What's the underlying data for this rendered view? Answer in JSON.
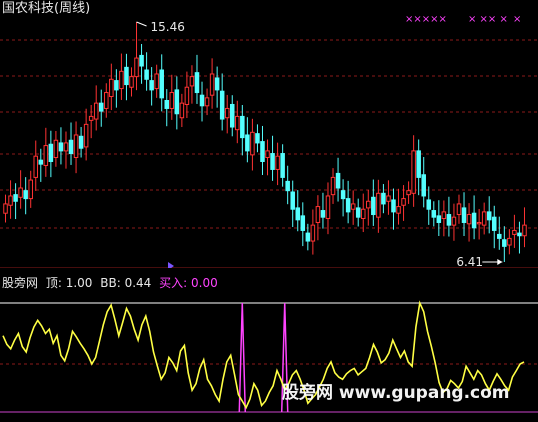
{
  "chart_title": "国农科技(周线)",
  "main_chart": {
    "high_label": "15.46",
    "low_label": "6.41",
    "colors": {
      "up": "#ff3333",
      "down": "#54ffff",
      "background": "#000000",
      "grid": "#8b1a1a",
      "marker": "#ff44ff"
    },
    "top_marker_groups": [
      "×××××",
      "× ×× ×",
      "×"
    ]
  },
  "indicator": {
    "name": "股旁网",
    "labels": [
      {
        "key": "顶",
        "value": "1.00"
      },
      {
        "key": "BB",
        "value": "0.44"
      },
      {
        "key": "买入",
        "value": "0.00"
      }
    ],
    "colors": {
      "line": "#ffff44",
      "buy": "#ff44ff",
      "top_line": "#ffffff",
      "baseline": "#cc44cc"
    }
  },
  "watermark": "股旁网  www.gupang.com",
  "chart_data": [
    {
      "type": "candlestick",
      "title": "国农科技(周线)",
      "annotations": [
        {
          "text": "15.46",
          "kind": "high"
        },
        {
          "text": "6.41",
          "kind": "low"
        }
      ],
      "close": [
        8.6,
        8.9,
        8.7,
        9.2,
        8.8,
        9.5,
        10.4,
        10.1,
        10.8,
        10.2,
        11.0,
        10.6,
        10.9,
        10.5,
        11.2,
        10.7,
        11.6,
        11.9,
        12.4,
        12.1,
        12.8,
        13.3,
        12.9,
        13.6,
        13.1,
        13.4,
        14.1,
        13.8,
        13.3,
        12.9,
        13.5,
        12.6,
        12.2,
        12.8,
        12.0,
        12.4,
        13.0,
        13.4,
        12.8,
        12.3,
        12.6,
        13.5,
        12.9,
        11.8,
        12.2,
        11.5,
        11.9,
        11.1,
        10.6,
        11.3,
        10.9,
        10.2,
        10.6,
        9.9,
        10.4,
        9.6,
        9.1,
        8.4,
        8.0,
        7.6,
        7.2,
        7.8,
        8.5,
        8.1,
        8.9,
        9.6,
        9.2,
        8.8,
        8.3,
        8.6,
        8.1,
        8.4,
        8.7,
        8.2,
        9.0,
        8.6,
        8.9,
        8.3,
        8.5,
        8.8,
        9.1,
        10.6,
        9.6,
        8.9,
        8.4,
        8.1,
        7.9,
        8.3,
        7.8,
        8.1,
        8.6,
        7.9,
        8.2,
        7.7,
        7.9,
        8.3,
        8.0,
        7.6,
        7.3,
        7.0,
        7.3,
        7.6,
        7.4,
        7.8
      ],
      "high_value": 15.46,
      "low_value": 6.41
    },
    {
      "type": "line",
      "title": "股旁网",
      "y": [
        0.7,
        0.62,
        0.58,
        0.66,
        0.72,
        0.6,
        0.55,
        0.68,
        0.78,
        0.84,
        0.79,
        0.72,
        0.76,
        0.63,
        0.7,
        0.52,
        0.47,
        0.58,
        0.74,
        0.69,
        0.63,
        0.58,
        0.52,
        0.44,
        0.5,
        0.65,
        0.8,
        0.92,
        0.98,
        0.85,
        0.7,
        0.82,
        0.95,
        0.88,
        0.76,
        0.66,
        0.8,
        0.88,
        0.74,
        0.55,
        0.42,
        0.3,
        0.36,
        0.5,
        0.45,
        0.38,
        0.56,
        0.61,
        0.36,
        0.2,
        0.26,
        0.4,
        0.48,
        0.3,
        0.24,
        0.16,
        0.1,
        0.3,
        0.46,
        0.52,
        0.34,
        0.16,
        0.1,
        0.04,
        0.12,
        0.26,
        0.2,
        0.06,
        0.1,
        0.18,
        0.24,
        0.38,
        0.3,
        0.2,
        0.26,
        0.34,
        0.38,
        0.3,
        0.2,
        0.08,
        0.12,
        0.16,
        0.23,
        0.3,
        0.4,
        0.46,
        0.36,
        0.32,
        0.3,
        0.35,
        0.38,
        0.4,
        0.34,
        0.37,
        0.4,
        0.5,
        0.62,
        0.55,
        0.45,
        0.48,
        0.54,
        0.66,
        0.58,
        0.5,
        0.56,
        0.46,
        0.42,
        0.78,
        1.0,
        0.92,
        0.74,
        0.6,
        0.45,
        0.27,
        0.18,
        0.21,
        0.29,
        0.26,
        0.22,
        0.28,
        0.42,
        0.36,
        0.3,
        0.38,
        0.34,
        0.26,
        0.2,
        0.28,
        0.35,
        0.3,
        0.24,
        0.2,
        0.32,
        0.38,
        0.44,
        0.46
      ],
      "buy_spikes": [
        {
          "index": 62,
          "value": 1.0
        },
        {
          "index": 73,
          "value": 1.0
        }
      ],
      "reference_lines": [
        {
          "label": "顶",
          "value": 1.0
        },
        {
          "label": "BB",
          "value": 0.44
        },
        {
          "label": "买入",
          "value": 0.0
        }
      ]
    }
  ]
}
